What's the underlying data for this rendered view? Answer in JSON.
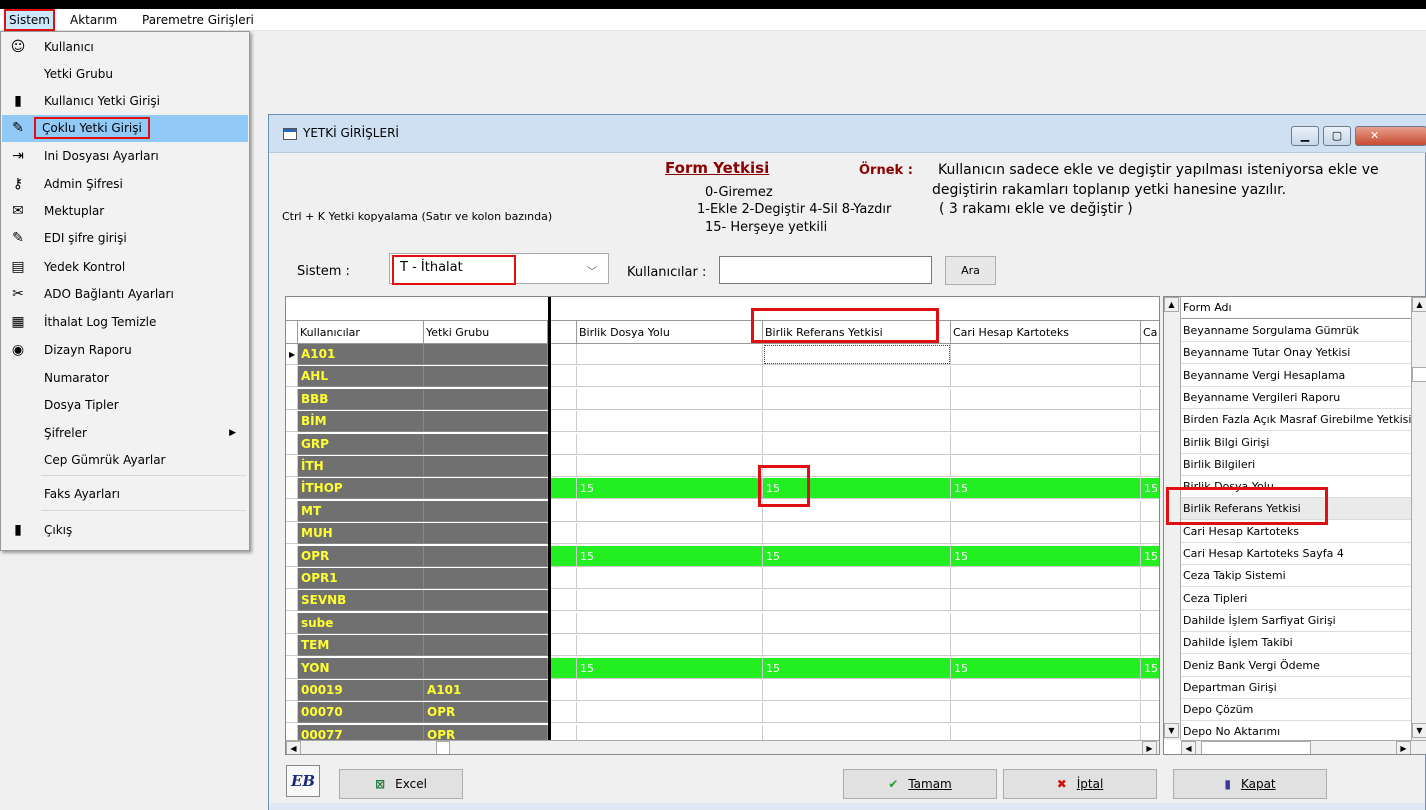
{
  "menubar": {
    "sistem": "Sistem",
    "aktarim": "Aktarım",
    "parametre": "Paremetre Girişleri"
  },
  "dropdown": {
    "items": [
      {
        "label": "Kullanıcı",
        "icon": "user-icon",
        "glyph": "☺"
      },
      {
        "label": "Yetki Grubu",
        "icon": "",
        "glyph": ""
      },
      {
        "label": "Kullanıcı Yetki Girişi",
        "icon": "bin-icon",
        "glyph": "▮"
      },
      {
        "label": "Çoklu Yetki Girişi",
        "icon": "tools-icon",
        "glyph": "✎"
      },
      {
        "label": "Ini Dosyası  Ayarları",
        "icon": "ini-icon",
        "glyph": "⇥"
      },
      {
        "label": "Admin Şifresi",
        "icon": "key-icon",
        "glyph": "⚷"
      },
      {
        "label": "Mektuplar",
        "icon": "letters-icon",
        "glyph": "✉"
      },
      {
        "label": "EDI şifre girişi",
        "icon": "edi-icon",
        "glyph": "✎"
      },
      {
        "label": "Yedek Kontrol",
        "icon": "backup-icon",
        "glyph": "▤"
      },
      {
        "label": "ADO Bağlantı Ayarları",
        "icon": "ado-icon",
        "glyph": "✂"
      },
      {
        "label": "İthalat Log Temizle",
        "icon": "log-icon",
        "glyph": "▦"
      },
      {
        "label": "Dizayn Raporu",
        "icon": "report-icon",
        "glyph": "◉"
      },
      {
        "label": "Numarator",
        "icon": "",
        "glyph": ""
      },
      {
        "label": "Dosya Tipler",
        "icon": "",
        "glyph": ""
      },
      {
        "label": "Şifreler",
        "icon": "",
        "glyph": ""
      },
      {
        "label": "Cep Gümrük Ayarlar",
        "icon": "",
        "glyph": ""
      },
      {
        "label": "Faks Ayarları",
        "icon": "",
        "glyph": ""
      },
      {
        "label": "Çıkış",
        "icon": "exit-icon",
        "glyph": "▮"
      }
    ],
    "highlighted_index": 3
  },
  "window": {
    "title": "YETKİ GİRİŞLERİ",
    "form_yetkisi": "Form Yetkisi",
    "legend": [
      "0-Giremez",
      "1-Ekle  2-Degiştir  4-Sil  8-Yazdır",
      "15- Herşeye yetkili"
    ],
    "ornek_label": "Örnek :",
    "explanation": [
      "Kullanıcın sadece ekle ve degiştir yapılması isteniyorsa  ekle ve",
      "degiştirin rakamları toplanıp yetki hanesine yazılır.",
      "( 3 rakamı ekle ve değiştir )"
    ],
    "ctrl_k_hint": "Ctrl + K Yetki kopyalama (Satır ve kolon bazında)",
    "sistem_label": "Sistem :",
    "sistem_value": "T - İthalat",
    "kullanicilar_label": "Kullanıcılar :",
    "kullanicilar_value": "",
    "ara_label": "Ara"
  },
  "grid": {
    "columns": [
      "Kullanıcılar",
      "Yetki Grubu",
      "Birlik Dosya Yolu",
      "Birlik Referans Yetkisi",
      "Cari Hesap Kartoteks",
      "Ca"
    ],
    "rows": [
      {
        "user": "A101",
        "group": "",
        "v": [
          "",
          "",
          "",
          ""
        ],
        "green": false
      },
      {
        "user": "AHL",
        "group": "",
        "v": [
          "",
          "",
          "",
          ""
        ],
        "green": false
      },
      {
        "user": "BBB",
        "group": "",
        "v": [
          "",
          "",
          "",
          ""
        ],
        "green": false
      },
      {
        "user": "BİM",
        "group": "",
        "v": [
          "",
          "",
          "",
          ""
        ],
        "green": false
      },
      {
        "user": "GRP",
        "group": "",
        "v": [
          "",
          "",
          "",
          ""
        ],
        "green": false
      },
      {
        "user": "İTH",
        "group": "",
        "v": [
          "",
          "",
          "",
          ""
        ],
        "green": false
      },
      {
        "user": "İTHOP",
        "group": "",
        "v": [
          "15",
          "15",
          "15",
          "15"
        ],
        "green": true
      },
      {
        "user": "MT",
        "group": "",
        "v": [
          "",
          "",
          "",
          ""
        ],
        "green": false
      },
      {
        "user": "MUH",
        "group": "",
        "v": [
          "",
          "",
          "",
          ""
        ],
        "green": false
      },
      {
        "user": "OPR",
        "group": "",
        "v": [
          "15",
          "15",
          "15",
          "15"
        ],
        "green": true
      },
      {
        "user": "OPR1",
        "group": "",
        "v": [
          "",
          "",
          "",
          ""
        ],
        "green": false
      },
      {
        "user": "SEVNB",
        "group": "",
        "v": [
          "",
          "",
          "",
          ""
        ],
        "green": false
      },
      {
        "user": "sube",
        "group": "",
        "v": [
          "",
          "",
          "",
          ""
        ],
        "green": false
      },
      {
        "user": "TEM",
        "group": "",
        "v": [
          "",
          "",
          "",
          ""
        ],
        "green": false
      },
      {
        "user": "YON",
        "group": "",
        "v": [
          "15",
          "15",
          "15",
          "15"
        ],
        "green": true
      },
      {
        "user": "00019",
        "group": "A101",
        "v": [
          "",
          "",
          "",
          ""
        ],
        "green": false
      },
      {
        "user": "00070",
        "group": "OPR",
        "v": [
          "",
          "",
          "",
          ""
        ],
        "green": false
      },
      {
        "user": "00077",
        "group": "OPR",
        "v": [
          "",
          "",
          "",
          ""
        ],
        "green": false
      }
    ]
  },
  "form_list": {
    "header": "Form Adı",
    "items": [
      "Beyanname Sorgulama Gümrük",
      "Beyanname Tutar Onay Yetkisi",
      "Beyanname Vergi Hesaplama",
      "Beyanname Vergileri Raporu",
      "Birden Fazla Açık Masraf Girebilme Yetkisi",
      "Birlik Bilgi Girişi",
      "Birlik Bilgileri",
      "Birlik Dosya Yolu",
      "Birlik Referans Yetkisi",
      "Cari Hesap Kartoteks",
      "Cari Hesap Kartoteks Sayfa 4",
      "Ceza Takip Sistemi",
      "Ceza Tipleri",
      "Dahilde İşlem Sarfiyat Girişi",
      "Dahilde İşlem Takibi",
      "Deniz Bank Vergi Ödeme",
      "Departman Girişi",
      "Depo Çözüm",
      "Depo No Aktarımı"
    ],
    "selected_index": 8
  },
  "buttons": {
    "logo": "EB",
    "excel": "Excel",
    "tamam": "Tamam",
    "iptal": "İptal",
    "kapat": "Kapat"
  },
  "colors": {
    "highlight_red": "#e01010",
    "grid_green": "#22ee22",
    "fixed_col_bg": "#707070",
    "fixed_col_text": "#ffff33"
  }
}
